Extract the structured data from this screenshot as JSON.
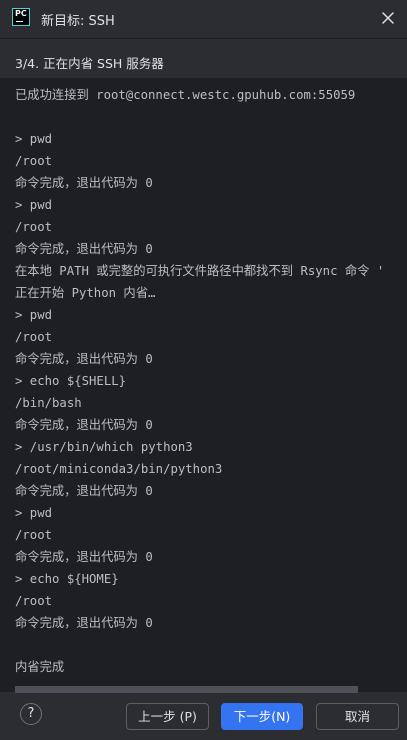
{
  "window": {
    "title": "新目标: SSH",
    "app_logo_text": "PC",
    "icons": {
      "app": "pycharm-logo-icon",
      "close": "close-icon",
      "help": "help-icon"
    }
  },
  "step": {
    "text": "3/4. 正在内省 SSH 服务器"
  },
  "console": {
    "lines": [
      "已成功连接到 root@connect.westc.gpuhub.com:55059",
      "",
      "> pwd",
      "/root",
      "命令完成，退出代码为 0",
      "> pwd",
      "/root",
      "命令完成，退出代码为 0",
      "在本地 PATH 或完整的可执行文件路径中都找不到 Rsync 命令 '",
      "正在开始 Python 内省…",
      "> pwd",
      "/root",
      "命令完成，退出代码为 0",
      "> echo ${SHELL}",
      "/bin/bash",
      "命令完成，退出代码为 0",
      "> /usr/bin/which python3",
      "/root/miniconda3/bin/python3",
      "命令完成，退出代码为 0",
      "> pwd",
      "/root",
      "命令完成，退出代码为 0",
      "> echo ${HOME}",
      "/root",
      "命令完成，退出代码为 0",
      "",
      "内省完成"
    ]
  },
  "footer": {
    "help_label": "?",
    "prev_label": "上一步 (P)",
    "next_label": "下一步(N)",
    "cancel_label": "取消"
  },
  "colors": {
    "accent": "#3574f0",
    "background": "#2b2d30",
    "console_bg": "#1e1f22"
  }
}
